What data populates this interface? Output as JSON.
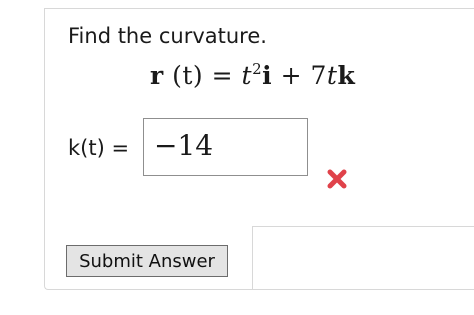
{
  "question": {
    "prompt": "Find the curvature.",
    "equation": {
      "lhs_vector": "r",
      "lhs_arg": "(t)",
      "equals": "=",
      "t1": "t",
      "t1_power": "2",
      "unit_i": "i",
      "plus": "+",
      "coef": "7",
      "t2": "t",
      "unit_k": "k"
    }
  },
  "answer": {
    "label": "k(t) =",
    "value": "−14",
    "status": "incorrect"
  },
  "icons": {
    "status_icon": "incorrect-x-icon",
    "status_color": "#e0424a"
  },
  "actions": {
    "submit_label": "Submit Answer"
  }
}
